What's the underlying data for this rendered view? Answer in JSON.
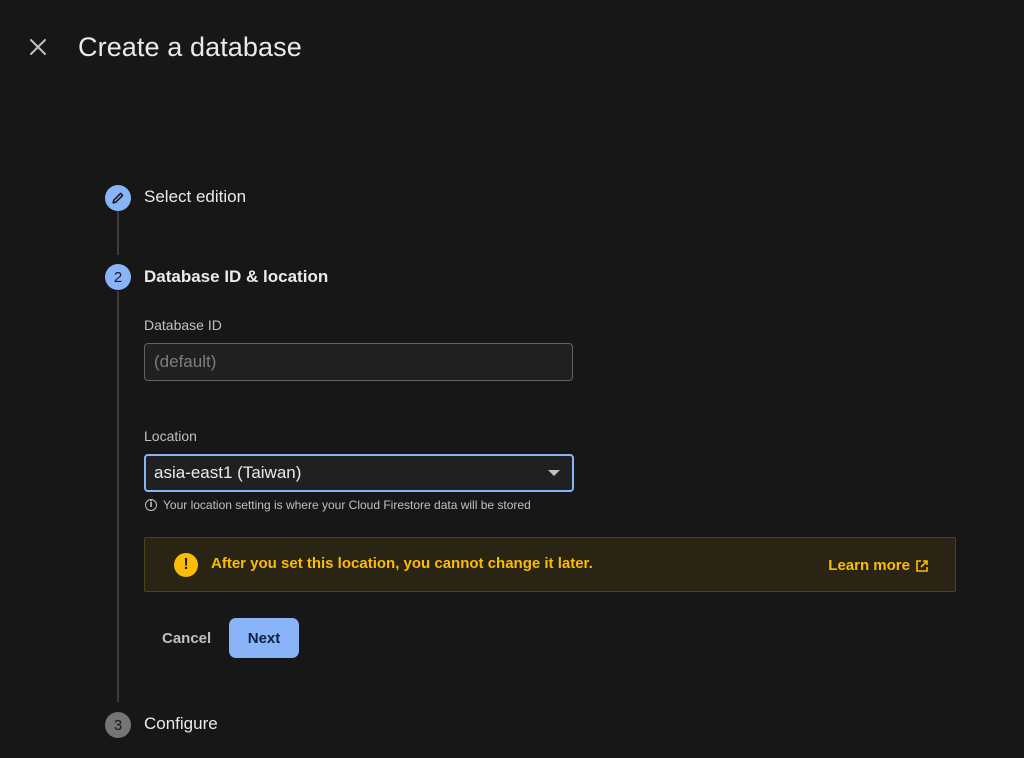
{
  "header": {
    "title": "Create a database",
    "close_icon": "close-icon"
  },
  "steps": [
    {
      "number": "1",
      "label": "Select edition",
      "state": "completed",
      "icon": "pencil-icon"
    },
    {
      "number": "2",
      "label": "Database ID & location",
      "state": "active"
    },
    {
      "number": "3",
      "label": "Configure",
      "state": "pending"
    }
  ],
  "form": {
    "database_id": {
      "label": "Database ID",
      "placeholder": "(default)",
      "value": ""
    },
    "location": {
      "label": "Location",
      "value": "asia-east1 (Taiwan)",
      "hint": "Your location setting is where your Cloud Firestore data will be stored",
      "hint_icon": "info-icon"
    }
  },
  "warning": {
    "icon": "warning-icon",
    "text": "After you set this location, you cannot change it later.",
    "link_label": "Learn more",
    "link_icon": "external-link-icon"
  },
  "actions": {
    "cancel_label": "Cancel",
    "next_label": "Next"
  },
  "colors": {
    "background": "#171717",
    "accent": "#8ab4f8",
    "warning": "#fbbc04"
  }
}
